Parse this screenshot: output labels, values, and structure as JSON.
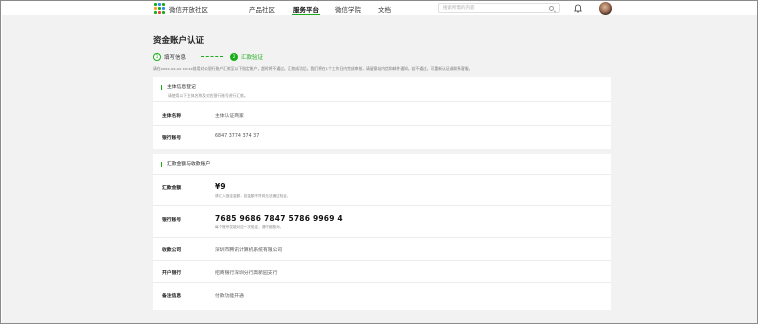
{
  "header": {
    "brand": "微信开放社区",
    "nav": [
      "产品社区",
      "服务平台",
      "微信学院",
      "文档"
    ],
    "search_placeholder": "搜索所需的内容"
  },
  "page": {
    "title": "资金账户认证",
    "steps": [
      {
        "index": "1",
        "label": "填写信息"
      },
      {
        "index": "2",
        "label": "汇款验证"
      }
    ],
    "notice": "请在xxxx-xx-xx xx:xx前用对公银行账户汇款至以下指定账户，超时将不通过。汇款成功后，我们将在1个工作日内完成审核，请留意站内信和邮件通知。若不通过，可重新认证或联系客服。"
  },
  "entity_card": {
    "title": "主体信息登记",
    "subtitle": "请使用以下主体名称及对应银行账号进行汇款。",
    "rows": [
      {
        "label": "主体名称",
        "value": "主体认证商家"
      },
      {
        "label": "银行账号",
        "value": "6847 3774 374 37"
      }
    ]
  },
  "remit_card": {
    "title": "汇款金额与收款账户",
    "amount_label": "汇款金额",
    "amount": "¥9",
    "amount_hint": "请汇入指定金额，若金额不符将无法通过验证。",
    "account_label": "银行账号",
    "account": "7685 9686 7847 5786 9969 4",
    "account_hint": "每个账号仅能对应一次验证，请仔细核对。",
    "rows": [
      {
        "label": "收款公司",
        "value": "深圳市腾讯计算机系统有限公司"
      },
      {
        "label": "开户银行",
        "value": "招商银行深圳分行高新园支行"
      },
      {
        "label": "备注信息",
        "value": "付款功能开通"
      }
    ]
  },
  "colors": {
    "accent": "#1aad19",
    "background": "#f2f2f2"
  }
}
